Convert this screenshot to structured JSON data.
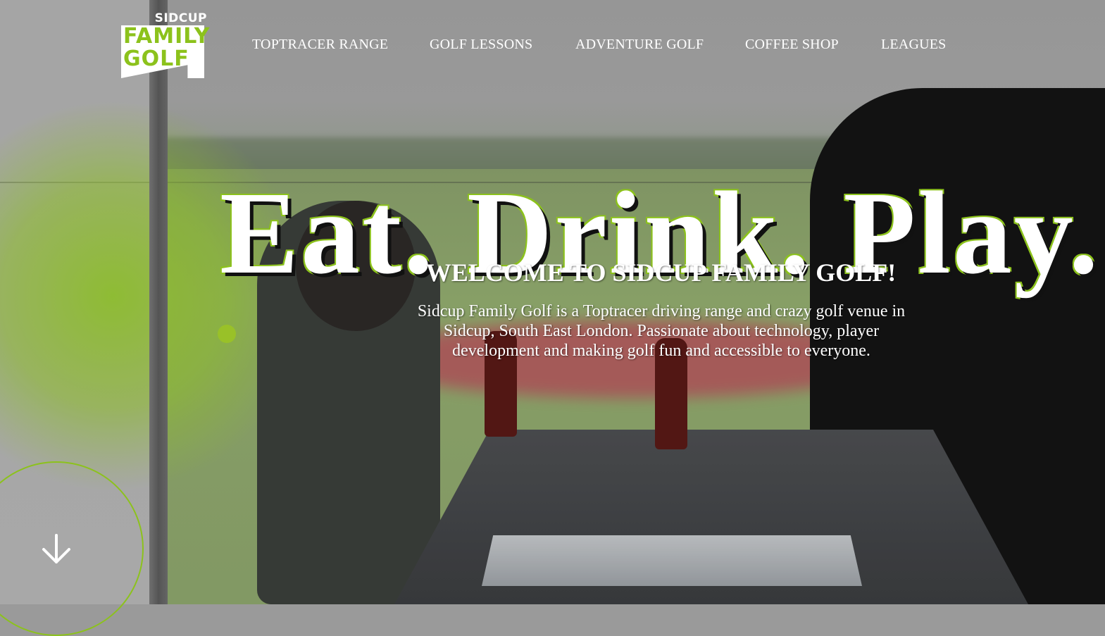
{
  "site": {
    "logo": {
      "line1": "SIDCUP",
      "line2": "FAMILY",
      "line3": "GOLF"
    },
    "nav": [
      {
        "label": "TOPTRACER RANGE"
      },
      {
        "label": "GOLF LESSONS"
      },
      {
        "label": "ADVENTURE GOLF"
      },
      {
        "label": "COFFEE SHOP"
      },
      {
        "label": "LEAGUES"
      }
    ]
  },
  "hero": {
    "headline": "Eat. Drink. Play.",
    "welcome": "WELCOME TO SIDCUP FAMILY GOLF!",
    "intro": "Sidcup Family Golf is a Toptracer driving range and crazy golf venue in Sidcup, South East London. Passionate about technology, player development and making golf fun and accessible to everyone.",
    "scroll_icon": "arrow-down-icon"
  },
  "colors": {
    "accent": "#8cc21c",
    "text": "#ffffff"
  }
}
